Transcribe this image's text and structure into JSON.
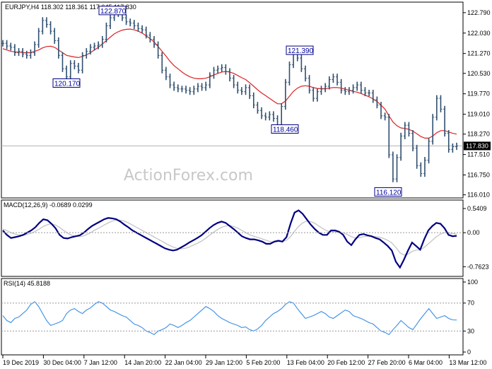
{
  "header": {
    "symbol_line": "EURJPY,H4  118.302 118.361 117.645 117.830",
    "macd_label": "MACD(12,26,9) -0.0689 0.0299",
    "rsi_label": "RSI(14) 45.8188"
  },
  "watermark": "ActionForex.com",
  "chart_data": [
    {
      "type": "line",
      "title": "",
      "subtitle": "EURJPY,H4",
      "price_axis": [
        122.79,
        122.03,
        121.27,
        120.53,
        119.77,
        119.01,
        118.27,
        117.51,
        116.75,
        116.01
      ],
      "ylim": [
        116.0,
        123.05
      ],
      "current_price": 117.83,
      "current_price_label": "117.830",
      "x_labels": [
        "19 Dec 2019",
        "30 Dec 04:00",
        "7 Jan 12:00",
        "14 Jan 20:00",
        "22 Jan 04:00",
        "29 Jan 12:00",
        "5 Feb 20:00",
        "13 Feb 04:00",
        "20 Feb 12:00",
        "27 Feb 20:00",
        "6 Mar 04:00",
        "13 Mar 12:00"
      ],
      "callouts": [
        {
          "label": "122.870",
          "value": 122.87
        },
        {
          "label": "120.170",
          "value": 120.17
        },
        {
          "label": "121.390",
          "value": 121.39
        },
        {
          "label": "118.460",
          "value": 118.46
        },
        {
          "label": "116.120",
          "value": 116.12
        }
      ],
      "series": [
        {
          "name": "",
          "color": "#2f4f6f",
          "role": "price",
          "values": [
            121.65,
            121.55,
            121.5,
            121.3,
            121.35,
            121.25,
            121.2,
            121.3,
            121.6,
            122.1,
            122.5,
            122.35,
            122.1,
            121.75,
            121.2,
            120.7,
            120.4,
            120.9,
            120.8,
            120.65,
            121.2,
            121.35,
            121.5,
            121.55,
            121.6,
            121.8,
            122.3,
            122.6,
            122.75,
            122.8,
            122.6,
            122.45,
            122.4,
            122.3,
            122.2,
            122.15,
            121.95,
            121.8,
            121.6,
            121.2,
            120.65,
            120.4,
            120.1,
            120.0,
            119.95,
            119.95,
            119.9,
            119.85,
            119.95,
            120.05,
            120.0,
            120.1,
            120.45,
            120.65,
            120.7,
            120.75,
            120.6,
            120.35,
            120.1,
            119.9,
            119.85,
            120.0,
            119.7,
            119.35,
            119.15,
            118.95,
            118.9,
            119.0,
            118.85,
            118.6,
            119.3,
            120.2,
            120.85,
            121.25,
            121.1,
            120.7,
            120.35,
            119.9,
            119.6,
            119.85,
            119.95,
            120.05,
            120.3,
            120.4,
            120.2,
            119.9,
            119.85,
            119.9,
            120.0,
            120.1,
            119.9,
            119.8,
            119.8,
            119.55,
            119.35,
            118.95,
            118.9,
            117.5,
            116.6,
            117.4,
            118.2,
            118.6,
            118.3,
            117.75,
            117.1,
            116.8,
            117.3,
            118.0,
            118.9,
            119.6,
            119.2,
            118.3,
            117.7,
            117.8,
            117.83
          ]
        },
        {
          "name": "",
          "color": "#dd2222",
          "role": "moving-average",
          "values": [
            121.45,
            121.4,
            121.35,
            121.33,
            121.32,
            121.3,
            121.3,
            121.3,
            121.35,
            121.4,
            121.48,
            121.53,
            121.54,
            121.5,
            121.4,
            121.3,
            121.2,
            121.17,
            121.14,
            121.12,
            121.16,
            121.22,
            121.3,
            121.4,
            121.5,
            121.62,
            121.75,
            121.88,
            122.0,
            122.08,
            122.14,
            122.17,
            122.18,
            122.15,
            122.1,
            122.03,
            121.93,
            121.82,
            121.7,
            121.53,
            121.35,
            121.17,
            120.98,
            120.82,
            120.7,
            120.58,
            120.48,
            120.4,
            120.35,
            120.33,
            120.33,
            120.35,
            120.4,
            120.47,
            120.53,
            120.58,
            120.6,
            120.58,
            120.53,
            120.45,
            120.37,
            120.3,
            120.18,
            120.05,
            119.92,
            119.8,
            119.7,
            119.6,
            119.5,
            119.4,
            119.4,
            119.5,
            119.68,
            119.86,
            119.98,
            120.05,
            120.07,
            120.05,
            120.0,
            119.97,
            119.96,
            119.96,
            119.98,
            120.0,
            120.0,
            119.98,
            119.94,
            119.9,
            119.86,
            119.83,
            119.78,
            119.72,
            119.66,
            119.58,
            119.48,
            119.35,
            119.2,
            118.95,
            118.72,
            118.58,
            118.5,
            118.48,
            118.45,
            118.38,
            118.28,
            118.18,
            118.12,
            118.12,
            118.2,
            118.32,
            118.4,
            118.4,
            118.35,
            118.3,
            118.27
          ]
        }
      ]
    },
    {
      "type": "line",
      "subtitle": "MACD(12,26,9)",
      "axis_labels": [
        "0.5409",
        "0.00",
        "-0.7623"
      ],
      "ylim": [
        -0.9,
        0.62
      ],
      "series": [
        {
          "name": "",
          "color": "#000080",
          "role": "macd",
          "values": [
            0.05,
            -0.05,
            -0.12,
            -0.1,
            -0.08,
            -0.05,
            0.0,
            0.05,
            0.12,
            0.22,
            0.3,
            0.28,
            0.2,
            0.1,
            -0.05,
            -0.12,
            -0.13,
            -0.1,
            -0.08,
            -0.06,
            0.0,
            0.08,
            0.15,
            0.2,
            0.25,
            0.3,
            0.33,
            0.32,
            0.3,
            0.25,
            0.18,
            0.12,
            0.05,
            0.0,
            -0.05,
            -0.1,
            -0.15,
            -0.2,
            -0.25,
            -0.3,
            -0.35,
            -0.38,
            -0.4,
            -0.38,
            -0.33,
            -0.28,
            -0.22,
            -0.17,
            -0.12,
            -0.06,
            0.02,
            0.1,
            0.17,
            0.22,
            0.25,
            0.22,
            0.15,
            0.08,
            0.0,
            -0.08,
            -0.12,
            -0.15,
            -0.15,
            -0.17,
            -0.2,
            -0.25,
            -0.25,
            -0.2,
            -0.18,
            -0.2,
            -0.1,
            0.2,
            0.45,
            0.5,
            0.42,
            0.3,
            0.18,
            0.08,
            0.0,
            -0.05,
            -0.05,
            0.05,
            0.05,
            0.02,
            -0.05,
            -0.2,
            -0.28,
            -0.15,
            -0.05,
            -0.03,
            -0.06,
            -0.08,
            -0.12,
            -0.15,
            -0.22,
            -0.3,
            -0.4,
            -0.65,
            -0.78,
            -0.6,
            -0.4,
            -0.22,
            -0.3,
            -0.38,
            -0.15,
            0.05,
            0.15,
            0.22,
            0.2,
            0.1,
            -0.05,
            -0.08,
            -0.07
          ]
        },
        {
          "name": "",
          "color": "#c0c0c0",
          "role": "signal",
          "values": [
            0.08,
            0.05,
            0.0,
            -0.03,
            -0.05,
            -0.06,
            -0.04,
            -0.01,
            0.03,
            0.08,
            0.14,
            0.18,
            0.2,
            0.17,
            0.12,
            0.05,
            -0.01,
            -0.06,
            -0.08,
            -0.09,
            -0.07,
            -0.03,
            0.02,
            0.07,
            0.12,
            0.17,
            0.22,
            0.26,
            0.28,
            0.28,
            0.26,
            0.22,
            0.17,
            0.12,
            0.07,
            0.02,
            -0.03,
            -0.08,
            -0.13,
            -0.18,
            -0.23,
            -0.28,
            -0.32,
            -0.35,
            -0.36,
            -0.35,
            -0.32,
            -0.28,
            -0.24,
            -0.19,
            -0.13,
            -0.06,
            0.01,
            0.07,
            0.12,
            0.15,
            0.16,
            0.14,
            0.1,
            0.05,
            0.0,
            -0.05,
            -0.08,
            -0.11,
            -0.14,
            -0.17,
            -0.2,
            -0.21,
            -0.2,
            -0.2,
            -0.17,
            -0.09,
            0.03,
            0.14,
            0.22,
            0.26,
            0.25,
            0.21,
            0.15,
            0.09,
            0.04,
            0.02,
            0.02,
            0.01,
            0.0,
            -0.04,
            -0.09,
            -0.12,
            -0.11,
            -0.09,
            -0.08,
            -0.08,
            -0.09,
            -0.1,
            -0.13,
            -0.17,
            -0.23,
            -0.33,
            -0.45,
            -0.5,
            -0.48,
            -0.42,
            -0.39,
            -0.38,
            -0.33,
            -0.25,
            -0.17,
            -0.09,
            -0.03,
            0.0,
            -0.01,
            -0.02,
            -0.03
          ]
        }
      ]
    },
    {
      "type": "line",
      "subtitle": "RSI(14)",
      "axis_labels": [
        "100",
        "70",
        "30",
        "0"
      ],
      "levels": [
        70,
        30
      ],
      "ylim": [
        0,
        100
      ],
      "series": [
        {
          "name": "",
          "color": "#3a8ee6",
          "role": "rsi",
          "values": [
            52,
            45,
            42,
            48,
            50,
            55,
            60,
            68,
            72,
            65,
            55,
            45,
            38,
            40,
            42,
            45,
            55,
            60,
            62,
            58,
            55,
            60,
            63,
            68,
            72,
            70,
            65,
            60,
            58,
            55,
            52,
            50,
            45,
            40,
            38,
            35,
            30,
            28,
            25,
            30,
            32,
            35,
            40,
            38,
            35,
            38,
            42,
            45,
            50,
            55,
            60,
            65,
            62,
            58,
            52,
            48,
            45,
            42,
            40,
            38,
            35,
            36,
            32,
            30,
            33,
            38,
            45,
            50,
            55,
            58,
            62,
            68,
            72,
            70,
            62,
            55,
            48,
            50,
            52,
            55,
            58,
            55,
            50,
            48,
            52,
            56,
            60,
            58,
            52,
            50,
            48,
            45,
            42,
            40,
            35,
            30,
            28,
            25,
            32,
            38,
            45,
            40,
            35,
            32,
            40,
            48,
            55,
            62,
            55,
            48,
            50,
            52,
            48,
            46,
            45.8
          ]
        }
      ]
    }
  ]
}
